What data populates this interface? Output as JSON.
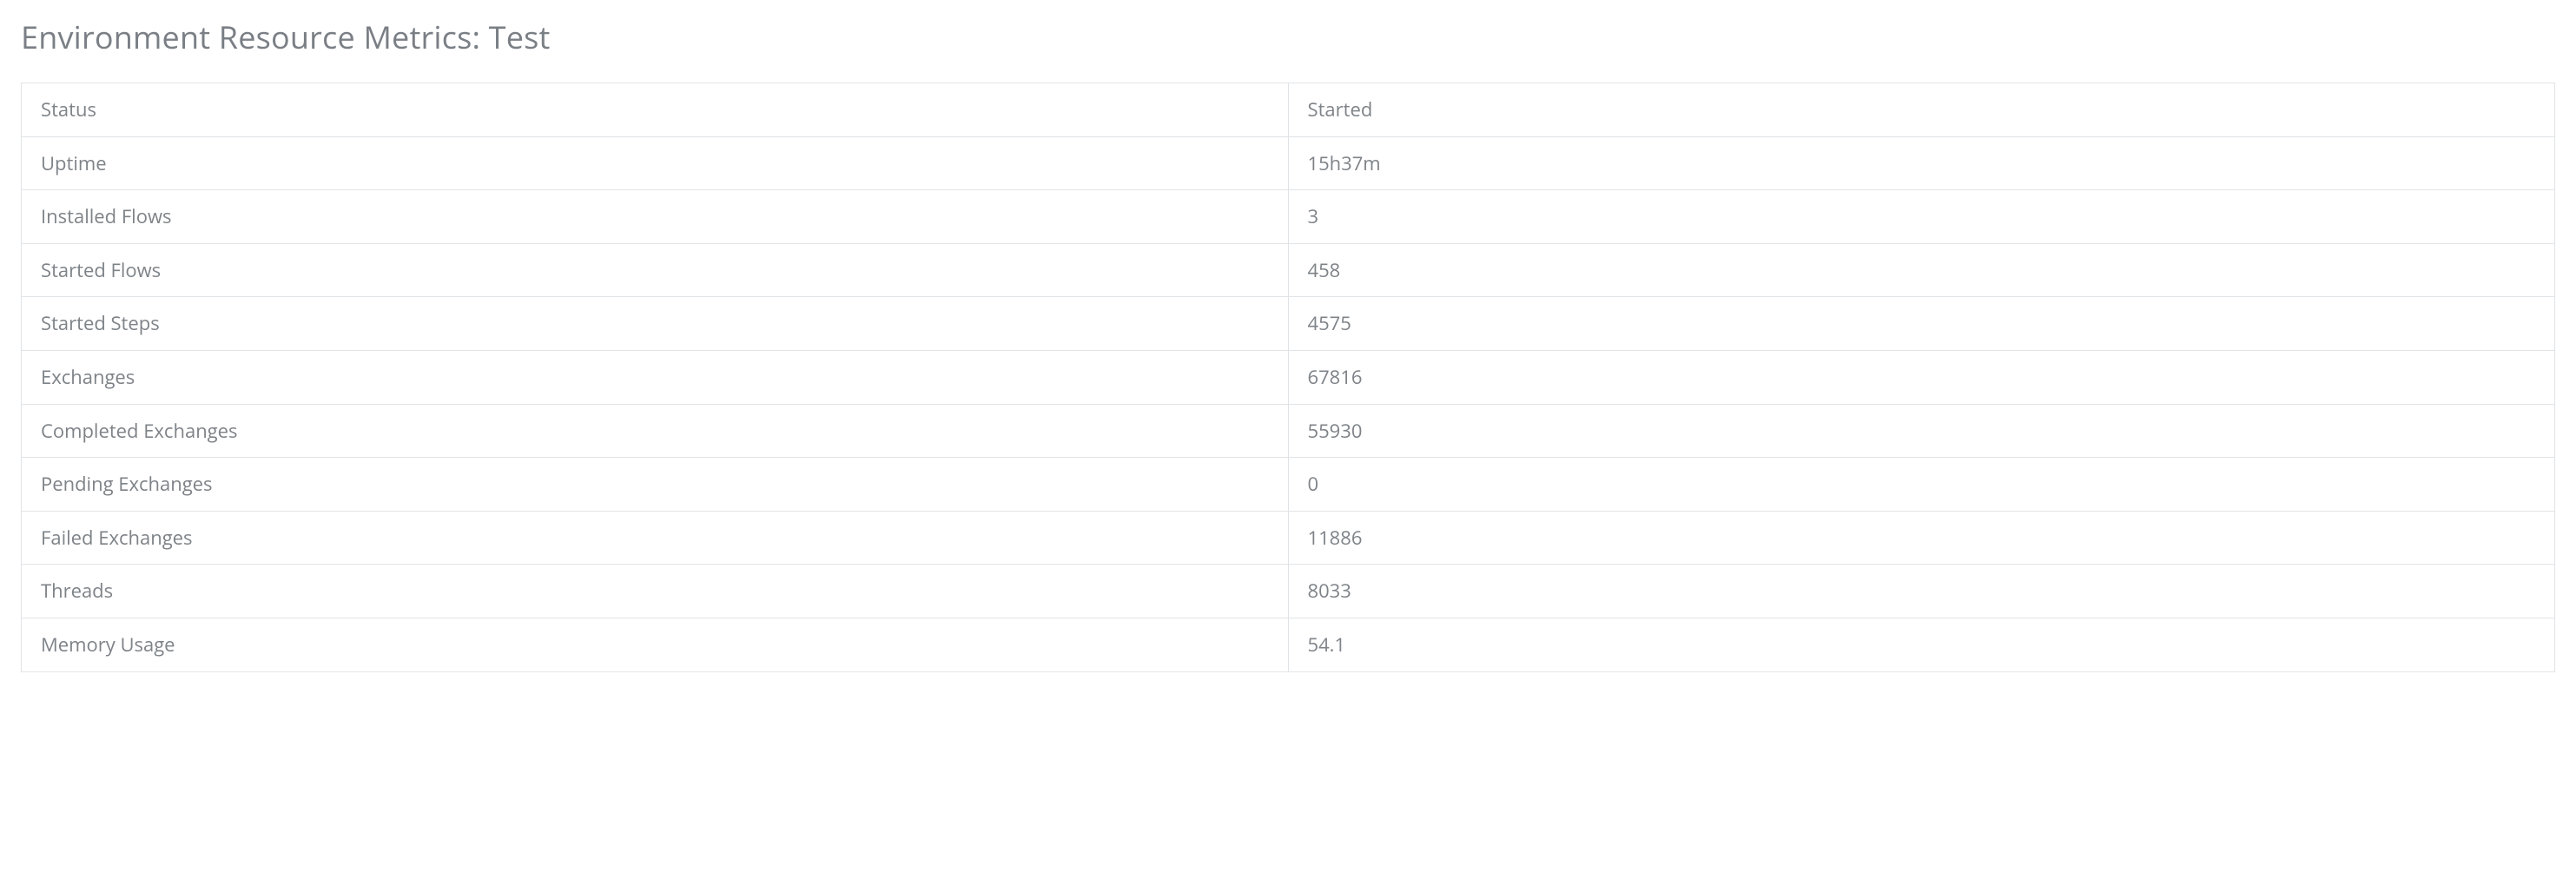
{
  "header": {
    "title": "Environment Resource Metrics: Test"
  },
  "metrics": {
    "rows": [
      {
        "label": "Status",
        "value": "Started"
      },
      {
        "label": "Uptime",
        "value": "15h37m"
      },
      {
        "label": "Installed Flows",
        "value": "3"
      },
      {
        "label": "Started Flows",
        "value": "458"
      },
      {
        "label": "Started Steps",
        "value": "4575"
      },
      {
        "label": "Exchanges",
        "value": "67816"
      },
      {
        "label": "Completed Exchanges",
        "value": "55930"
      },
      {
        "label": "Pending Exchanges",
        "value": "0"
      },
      {
        "label": "Failed Exchanges",
        "value": "11886"
      },
      {
        "label": "Threads",
        "value": "8033"
      },
      {
        "label": "Memory Usage",
        "value": "54.1"
      }
    ]
  }
}
